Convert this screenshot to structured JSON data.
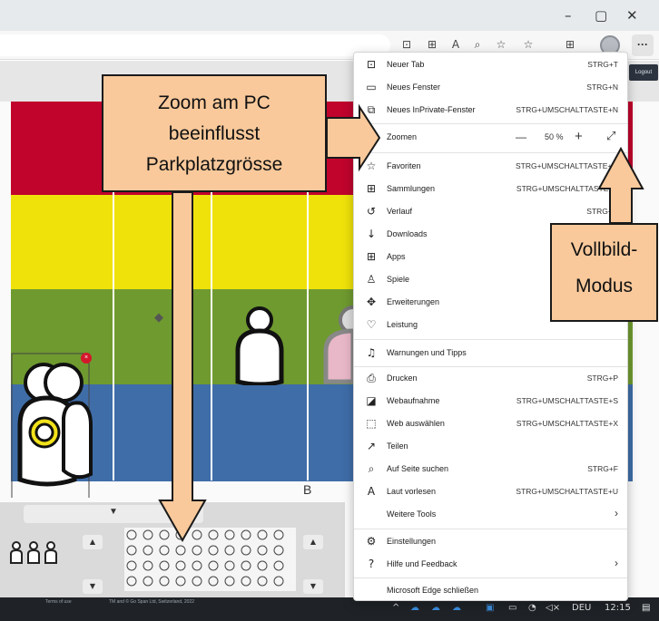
{
  "window": {
    "minimize": "–",
    "restore": "▢",
    "close": "✕"
  },
  "toolbar": {
    "more_label": "···"
  },
  "page": {
    "logout_label": "Logout",
    "column_label": "B",
    "footer_left": "Terms of use",
    "footer_mid": "TM and © Go Span Ltd, Switzerland, 2022"
  },
  "menu": {
    "items": [
      {
        "label": "Neuer Tab",
        "shortcut": "STRG+T",
        "icon": "new-tab-icon",
        "glyph": "⊡"
      },
      {
        "label": "Neues Fenster",
        "shortcut": "STRG+N",
        "icon": "new-window-icon",
        "glyph": "▭"
      },
      {
        "label": "Neues InPrivate-Fenster",
        "shortcut": "STRG+UMSCHALTTASTE+N",
        "icon": "inprivate-icon",
        "glyph": "⧉"
      },
      {
        "label": "Zoomen",
        "shortcut": "",
        "icon": "",
        "glyph": ""
      },
      {
        "label": "Favoriten",
        "shortcut": "STRG+UMSCHALTTASTE+O",
        "icon": "favorites-icon",
        "glyph": "☆"
      },
      {
        "label": "Sammlungen",
        "shortcut": "STRG+UMSCHALTTASTE+Y",
        "icon": "collections-icon",
        "glyph": "⊞"
      },
      {
        "label": "Verlauf",
        "shortcut": "STRG+H",
        "icon": "history-icon",
        "glyph": "↺"
      },
      {
        "label": "Downloads",
        "shortcut": "",
        "icon": "download-icon",
        "glyph": "↓"
      },
      {
        "label": "Apps",
        "shortcut": "",
        "icon": "apps-icon",
        "glyph": "⊞"
      },
      {
        "label": "Spiele",
        "shortcut": "",
        "icon": "games-icon",
        "glyph": "♙"
      },
      {
        "label": "Erweiterungen",
        "shortcut": "",
        "icon": "extensions-icon",
        "glyph": "✥"
      },
      {
        "label": "Leistung",
        "shortcut": "",
        "icon": "performance-icon",
        "glyph": "♡"
      },
      {
        "label": "Warnungen und Tipps",
        "shortcut": "",
        "icon": "bell-icon",
        "glyph": "♫"
      },
      {
        "label": "Drucken",
        "shortcut": "STRG+P",
        "icon": "print-icon",
        "glyph": "⎙"
      },
      {
        "label": "Webaufnahme",
        "shortcut": "STRG+UMSCHALTTASTE+S",
        "icon": "web-capture-icon",
        "glyph": "◪"
      },
      {
        "label": "Web auswählen",
        "shortcut": "STRG+UMSCHALTTASTE+X",
        "icon": "web-select-icon",
        "glyph": "⬚"
      },
      {
        "label": "Teilen",
        "shortcut": "",
        "icon": "share-icon",
        "glyph": "↗"
      },
      {
        "label": "Auf Seite suchen",
        "shortcut": "STRG+F",
        "icon": "find-icon",
        "glyph": "⌕"
      },
      {
        "label": "Laut vorlesen",
        "shortcut": "STRG+UMSCHALTTASTE+U",
        "icon": "read-aloud-icon",
        "glyph": "A"
      },
      {
        "label": "Weitere Tools",
        "shortcut": "›",
        "icon": "",
        "glyph": ""
      },
      {
        "label": "Einstellungen",
        "shortcut": "",
        "icon": "settings-icon",
        "glyph": "⚙"
      },
      {
        "label": "Hilfe und Feedback",
        "shortcut": "›",
        "icon": "help-icon",
        "glyph": "?"
      },
      {
        "label": "Microsoft Edge schließen",
        "shortcut": "",
        "icon": "",
        "glyph": ""
      }
    ],
    "zoom": {
      "minus": "—",
      "value": "50 %",
      "plus": "+",
      "fullscreen": "⤢"
    }
  },
  "callouts": {
    "main_lines": [
      "Zoom am PC",
      "beeinflusst",
      "Parkplatzgrösse"
    ],
    "side_lines": [
      "Vollbild-",
      "Modus"
    ]
  },
  "taskbar": {
    "lang": "DEU",
    "time": "12:15"
  },
  "colors": {
    "red": "#c0042c",
    "yellow": "#efe20b",
    "green": "#6f9a2f",
    "blue": "#3f6da8",
    "callout": "#f9c99b"
  }
}
